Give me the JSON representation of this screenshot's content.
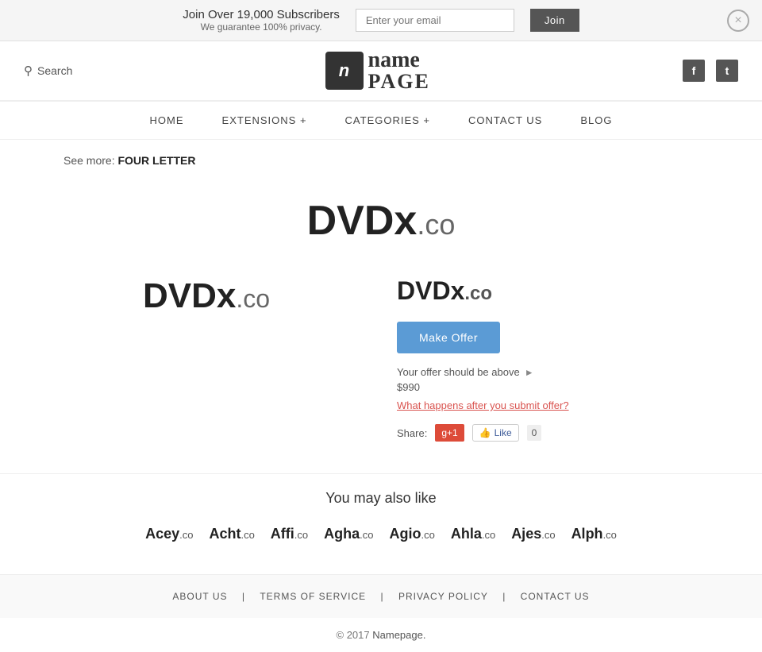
{
  "banner": {
    "headline": "Join Over 19,000 Subscribers",
    "subline": "We guarantee 100% privacy.",
    "email_placeholder": "Enter your email",
    "join_label": "Join",
    "close_symbol": "×"
  },
  "header": {
    "search_label": "Search",
    "logo_letter": "n",
    "logo_name": "name",
    "logo_page": "PAGE",
    "social": {
      "facebook": "f",
      "twitter": "t"
    }
  },
  "nav": {
    "items": [
      {
        "label": "HOME"
      },
      {
        "label": "EXTENSIONS +"
      },
      {
        "label": "CATEGORIES +"
      },
      {
        "label": "CONTACT  US"
      },
      {
        "label": "BLOG"
      }
    ]
  },
  "breadcrumb": {
    "prefix": "See more:",
    "link": "FOUR LETTER"
  },
  "domain": {
    "name": "DVDx",
    "extension": ".co",
    "full": "DVDx.co",
    "title": "DVDx.co",
    "offer_button": "Make Offer",
    "offer_note": "Your offer should be above",
    "offer_price": "$990",
    "offer_link": "What happens after you submit offer?",
    "share_label": "Share:",
    "gplus_label": "g+1",
    "fb_label": "Like",
    "fb_count": "0"
  },
  "similar": {
    "title": "You may also like",
    "items": [
      {
        "name": "Acey",
        "ext": ".co"
      },
      {
        "name": "Acht",
        "ext": ".co"
      },
      {
        "name": "Affi",
        "ext": ".co"
      },
      {
        "name": "Agha",
        "ext": ".co"
      },
      {
        "name": "Agio",
        "ext": ".co"
      },
      {
        "name": "Ahla",
        "ext": ".co"
      },
      {
        "name": "Ajes",
        "ext": ".co"
      },
      {
        "name": "Alph",
        "ext": ".co"
      }
    ]
  },
  "footer": {
    "links": [
      {
        "label": "ABOUT  US",
        "href": "#"
      },
      {
        "label": "TERMS  OF  SERVICE",
        "href": "#"
      },
      {
        "label": "PRIVACY  POLICY",
        "href": "#"
      },
      {
        "label": "CONTACT  US",
        "href": "#"
      }
    ],
    "copyright": "© 2017",
    "site_name": "Namepage."
  }
}
